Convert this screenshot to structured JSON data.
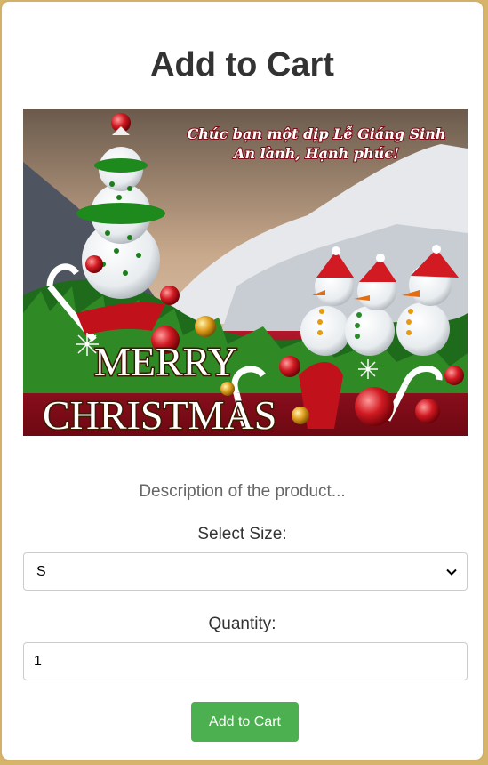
{
  "page": {
    "title": "Add to Cart"
  },
  "product": {
    "image_greeting_line1": "Chúc bạn một dịp Lễ Giáng Sinh",
    "image_greeting_line2": "An lành, Hạnh phúc!",
    "image_text_line1": "MERRY",
    "image_text_line2": "CHRISTMAS",
    "description": "Description of the product..."
  },
  "form": {
    "size_label": "Select Size:",
    "size_selected": "S",
    "quantity_label": "Quantity:",
    "quantity_value": "1",
    "submit_label": "Add to Cart"
  },
  "colors": {
    "button_bg": "#4caf50",
    "page_border": "#d2b06a",
    "title": "#333333"
  }
}
